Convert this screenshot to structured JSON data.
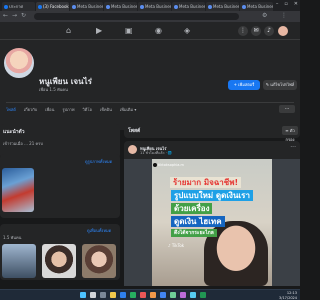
{
  "browser": {
    "tabs": [
      {
        "label": "ประกาศ"
      },
      {
        "label": "(3) Facebook"
      },
      {
        "label": "Meta Business Si"
      },
      {
        "label": "Meta Business Si"
      },
      {
        "label": "Meta Business Si"
      },
      {
        "label": "Meta Business Si"
      },
      {
        "label": "Meta Business Si"
      },
      {
        "label": "Meta Business Si"
      }
    ]
  },
  "profile": {
    "name": "หนูเพียน เจนไร่",
    "friends": "เพื่อน 1.5 พันคน",
    "add_story": "+ เพิ่มสตอรี่",
    "edit_profile": "✎ แก้ไขโปรไฟล์",
    "tabs": [
      "โพสต์",
      "เกี่ยวกับ",
      "เพื่อน",
      "รูปภาพ",
      "วิดีโอ",
      "เช็คอิน",
      "เพิ่มเติม ▾"
    ],
    "more": "···"
  },
  "intro": {
    "title": "แนะนำตัว",
    "line": "เข้าร่วมเมื่อ ... 21 ครบ"
  },
  "photos": {
    "link": "ดูรูปภาพทั้งหมด"
  },
  "friends_card": {
    "count": "1.5 พันคน",
    "link": "ดูเพื่อนทั้งหมด"
  },
  "posts": {
    "title": "โพสต์",
    "filter": "≡ ตัวกรอง"
  },
  "post": {
    "author": "หนูเพียน เจนไร่",
    "meta": "11 ชั่วโมงที่แล้ว · 🌐",
    "video": {
      "tiktok_user": "tiktoksophia.m",
      "captions": [
        "ร้ายมาก มิจฉาชีพ!",
        "รูปแบบใหม่ ดูดเงินเรา",
        "ด้วยเครื่อง",
        "ดูดเงิน ไฮเทค",
        "ดึงได้จากระยะไกล"
      ],
      "logo": "♪ TikTok"
    }
  },
  "taskbar": {
    "clock_time": "12:13",
    "clock_date": "3/17/2024"
  },
  "colors": {
    "accent": "#1877f2",
    "background": "#18191a",
    "card": "#242526"
  }
}
